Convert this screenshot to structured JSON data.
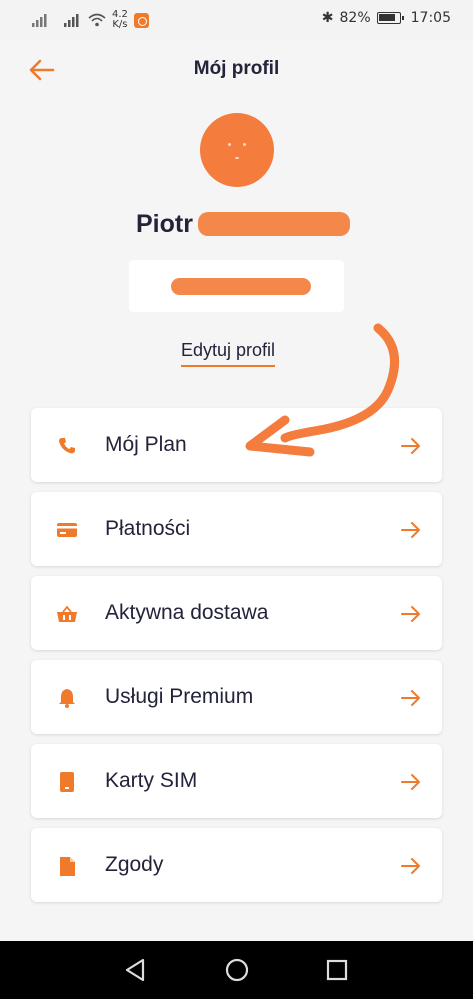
{
  "status_bar": {
    "speed_value": "4.2",
    "speed_unit": "K/s",
    "battery_percent": "82%",
    "time": "17:05"
  },
  "header": {
    "title": "Mój profil"
  },
  "profile": {
    "first_name": "Piotr",
    "edit_label": "Edytuj profil"
  },
  "menu": {
    "items": [
      {
        "label": "Mój Plan",
        "icon": "phone-icon"
      },
      {
        "label": "Płatności",
        "icon": "credit-card-icon"
      },
      {
        "label": "Aktywna dostawa",
        "icon": "basket-icon"
      },
      {
        "label": "Usługi Premium",
        "icon": "bell-icon"
      },
      {
        "label": "Karty SIM",
        "icon": "sim-card-icon"
      },
      {
        "label": "Zgody",
        "icon": "document-icon"
      }
    ]
  },
  "colors": {
    "accent": "#f07a2c",
    "text": "#23233a",
    "background": "#f5f5f6"
  }
}
